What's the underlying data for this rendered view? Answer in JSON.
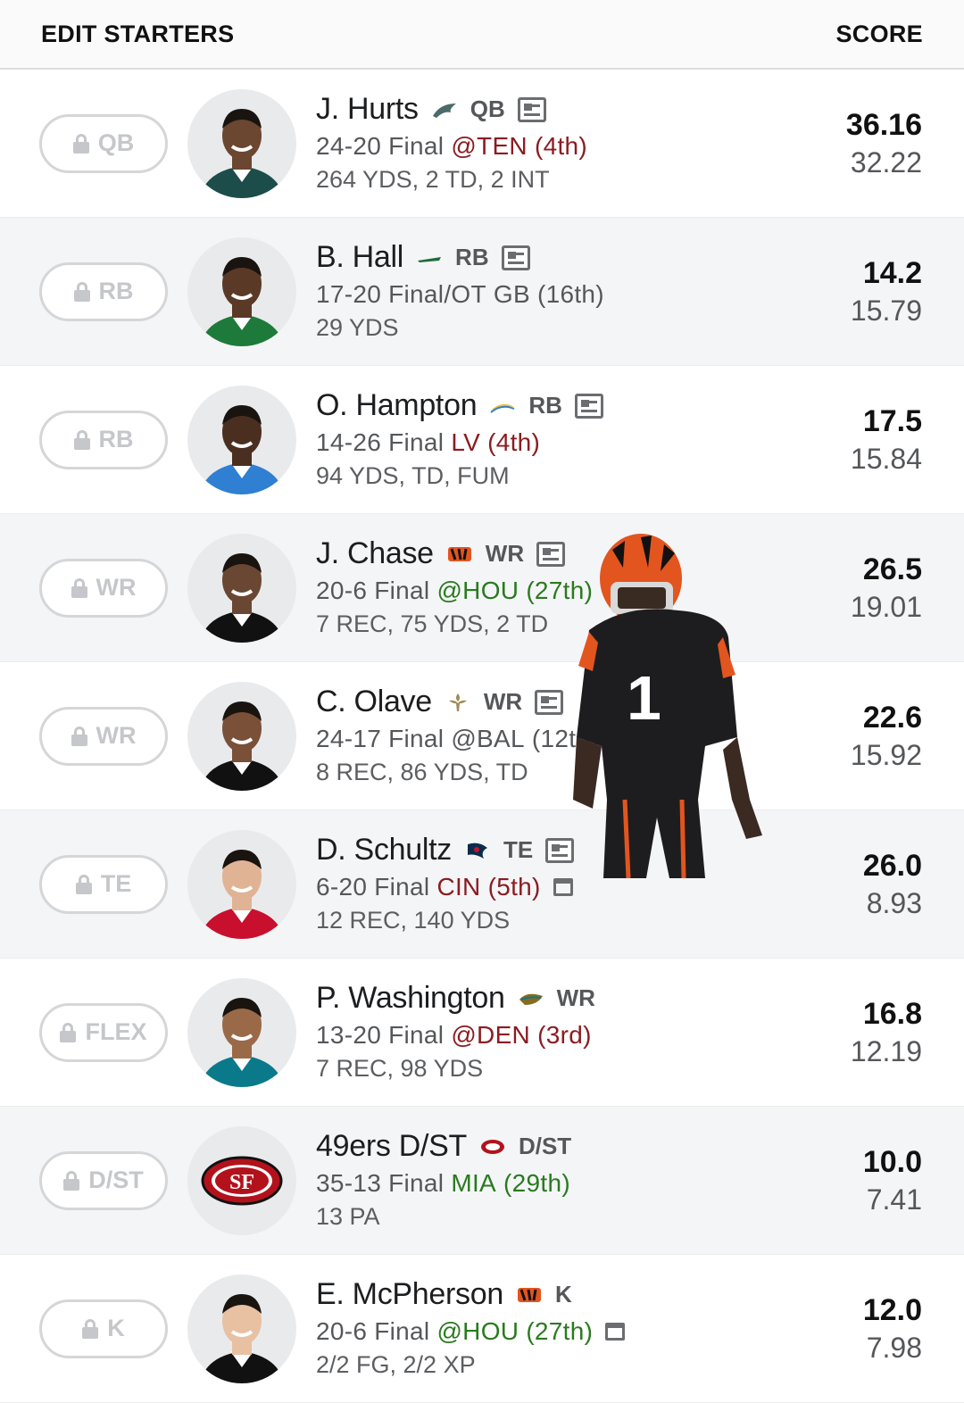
{
  "header": {
    "title": "EDIT STARTERS",
    "score_label": "SCORE"
  },
  "colors": {
    "opponent_bad": "#8b1c22",
    "opponent_good": "#2a7a1f",
    "row_alt": "#f4f5f7"
  },
  "rows": [
    {
      "slot": "QB",
      "name": "J. Hurts",
      "team_icon": "eagles-logo-icon",
      "position": "QB",
      "news": true,
      "calendar": false,
      "result": "24-20",
      "status": "Final",
      "opponent": "@TEN",
      "rank": "(4th)",
      "rank_tone": "bad",
      "stats": "264 YDS, 2 TD, 2 INT",
      "actual": "36.16",
      "projected": "32.22"
    },
    {
      "slot": "RB",
      "name": "B. Hall",
      "team_icon": "jets-logo-icon",
      "position": "RB",
      "news": true,
      "calendar": false,
      "result": "17-20",
      "status": "Final/OT",
      "opponent": "GB",
      "rank": "(16th)",
      "rank_tone": "neutral",
      "stats": "29 YDS",
      "actual": "14.2",
      "projected": "15.79"
    },
    {
      "slot": "RB",
      "name": "O. Hampton",
      "team_icon": "chargers-logo-icon",
      "position": "RB",
      "news": true,
      "calendar": false,
      "result": "14-26",
      "status": "Final",
      "opponent": "LV",
      "rank": "(4th)",
      "rank_tone": "bad",
      "stats": "94 YDS, TD, FUM",
      "actual": "17.5",
      "projected": "15.84"
    },
    {
      "slot": "WR",
      "name": "J. Chase",
      "team_icon": "bengals-logo-icon",
      "position": "WR",
      "news": true,
      "calendar": false,
      "result": "20-6",
      "status": "Final",
      "opponent": "@HOU",
      "rank": "(27th)",
      "rank_tone": "good",
      "stats": "7 REC, 75 YDS, 2 TD",
      "actual": "26.5",
      "projected": "19.01"
    },
    {
      "slot": "WR",
      "name": "C. Olave",
      "team_icon": "saints-logo-icon",
      "position": "WR",
      "news": true,
      "calendar": false,
      "result": "24-17",
      "status": "Final",
      "opponent": "@BAL",
      "rank": "(12th)",
      "rank_tone": "neutral",
      "stats": "8 REC, 86 YDS, TD",
      "actual": "22.6",
      "projected": "15.92"
    },
    {
      "slot": "TE",
      "name": "D. Schultz",
      "team_icon": "texans-logo-icon",
      "position": "TE",
      "news": true,
      "calendar": true,
      "result": "6-20",
      "status": "Final",
      "opponent": "CIN",
      "rank": "(5th)",
      "rank_tone": "bad",
      "stats": "12 REC, 140 YDS",
      "actual": "26.0",
      "projected": "8.93"
    },
    {
      "slot": "FLEX",
      "name": "P. Washington",
      "team_icon": "jaguars-logo-icon",
      "position": "WR",
      "news": false,
      "calendar": false,
      "result": "13-20",
      "status": "Final",
      "opponent": "@DEN",
      "rank": "(3rd)",
      "rank_tone": "bad",
      "stats": "7 REC, 98 YDS",
      "actual": "16.8",
      "projected": "12.19"
    },
    {
      "slot": "D/ST",
      "name": "49ers D/ST",
      "team_icon": "49ers-logo-icon",
      "position": "D/ST",
      "news": false,
      "calendar": false,
      "result": "35-13",
      "status": "Final",
      "opponent": "MIA",
      "rank": "(29th)",
      "rank_tone": "good",
      "stats": "13 PA",
      "actual": "10.0",
      "projected": "7.41"
    },
    {
      "slot": "K",
      "name": "E. McPherson",
      "team_icon": "bengals-logo-icon",
      "position": "K",
      "news": false,
      "calendar": true,
      "result": "20-6",
      "status": "Final",
      "opponent": "@HOU",
      "rank": "(27th)",
      "rank_tone": "good",
      "stats": "2/2 FG, 2/2 XP",
      "actual": "12.0",
      "projected": "7.98"
    }
  ]
}
